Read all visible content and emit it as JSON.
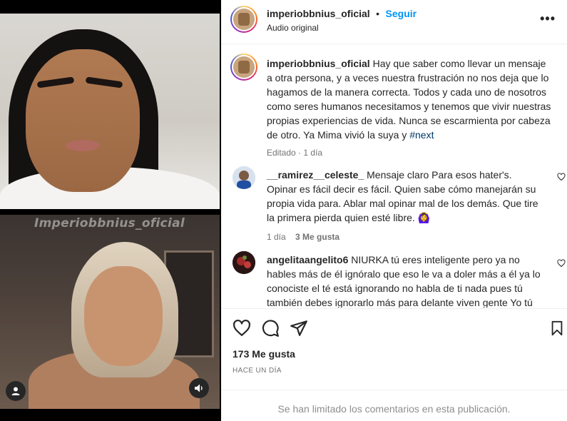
{
  "media": {
    "watermark": "Imperiobbnius_oficial"
  },
  "header": {
    "username": "imperiobbnius_oficial",
    "separator": "•",
    "follow_label": "Seguir",
    "audio_label": "Audio original",
    "more_label": "•••"
  },
  "caption": {
    "username": "imperiobbnius_oficial",
    "text": "Hay que saber como llevar un mensaje a otra persona, y a veces nuestra frustración no nos deja que lo hagamos de la manera correcta. Todos y cada uno de nosotros como seres humanos necesitamos y tenemos que vivir nuestras propias experiencias de vida. Nunca se escarmienta por cabeza de otro. Ya Mima vivió la suya y",
    "hashtag": "#next",
    "edited": "Editado",
    "time": "1 día"
  },
  "comments": [
    {
      "username": "__ramirez__celeste_",
      "text": "Mensaje claro Para esos hater's. Opinar es fácil decir es fácil. Quien sabe cómo manejarán su propia vida para. Ablar mal opinar mal de los demás. Que tire la primera pierda quien esté libre. 🙆‍♀️",
      "time": "1 día",
      "likes": "3 Me gusta"
    },
    {
      "username": "angelitaangelito6",
      "text": "NIURKA tú eres inteligente pero ya no hables más de él ignóralo que eso le va a doler más a él ya lo conociste el té está ignorando no habla de ti nada pues tú también debes ignorarlo más para delante viven gente Yo tú ni"
    }
  ],
  "actions": {
    "likes": "173 Me gusta",
    "ago": "HACE UN DÍA"
  },
  "footer": {
    "limited": "Se han limitado los comentarios en esta publicación."
  },
  "colors": {
    "accent": "#0095f6",
    "text": "#262626",
    "muted": "#737373"
  }
}
